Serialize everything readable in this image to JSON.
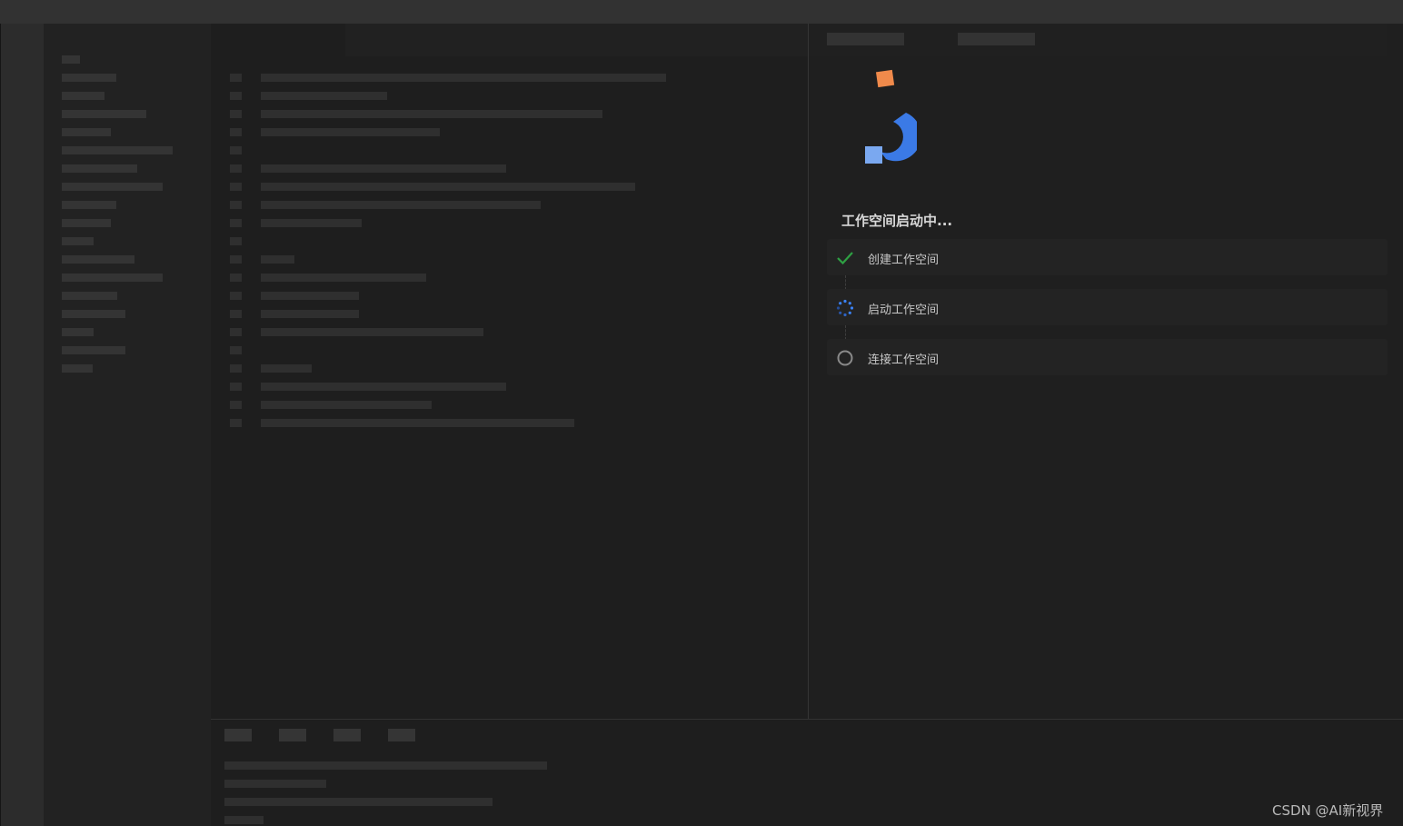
{
  "workspace_loader": {
    "title": "工作空间启动中...",
    "steps": [
      {
        "label": "创建工作空间",
        "status": "done",
        "icon": "check-icon"
      },
      {
        "label": "启动工作空间",
        "status": "in-progress",
        "icon": "spinner-icon"
      },
      {
        "label": "连接工作空间",
        "status": "pending",
        "icon": "circle-icon"
      }
    ]
  },
  "watermark": "CSDN @AI新视界",
  "colors": {
    "done": "#2ea043",
    "in_progress": "#3b82f6",
    "pending": "#8a8a8a",
    "logo_orange": "#f08a4b",
    "logo_blue": "#3b7ae6",
    "logo_light_blue": "#7aa8f0"
  }
}
